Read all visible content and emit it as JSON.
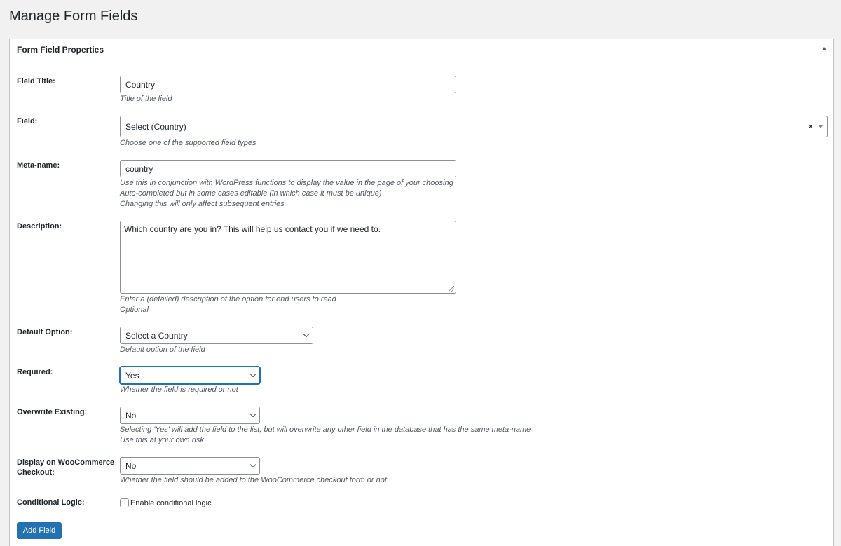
{
  "page": {
    "title": "Manage Form Fields"
  },
  "panel": {
    "title": "Form Field Properties"
  },
  "fields": {
    "title": {
      "label": "Field Title:",
      "value": "Country",
      "desc": [
        "Title of the field"
      ]
    },
    "field": {
      "label": "Field:",
      "value": "Select (Country)",
      "clear": "×",
      "desc": [
        "Choose one of the supported field types"
      ]
    },
    "meta": {
      "label": "Meta-name:",
      "value": "country",
      "desc": [
        "Use this in conjunction with WordPress functions to display the value in the page of your choosing",
        "Auto-completed but in some cases editable (in which case it must be unique)",
        "Changing this will only affect subsequent entries"
      ]
    },
    "description": {
      "label": "Description:",
      "value": "Which country are you in? This will help us contact you if we need to.",
      "desc": [
        "Enter a (detailed) description of the option for end users to read",
        "Optional"
      ]
    },
    "default_option": {
      "label": "Default Option:",
      "value": "Select a Country",
      "desc": [
        "Default option of the field"
      ]
    },
    "required": {
      "label": "Required:",
      "value": "Yes",
      "desc": [
        "Whether the field is required or not"
      ]
    },
    "overwrite": {
      "label": "Overwrite Existing:",
      "value": "No",
      "desc": [
        "Selecting 'Yes' will add the field to the list, but will overwrite any other field in the database that has the same meta-name",
        "Use this at your own risk"
      ]
    },
    "woocommerce": {
      "label_line1": "Display on WooCommerce",
      "label_line2": "Checkout:",
      "value": "No",
      "desc": [
        "Whether the field should be added to the WooCommerce checkout form or not"
      ]
    },
    "conditional": {
      "label": "Conditional Logic:",
      "checkbox_label": "Enable conditional logic"
    }
  },
  "actions": {
    "add_field": "Add Field"
  },
  "colors": {
    "primary": "#2271b1",
    "background": "#f1f1f1",
    "border": "#c3c4c7"
  }
}
